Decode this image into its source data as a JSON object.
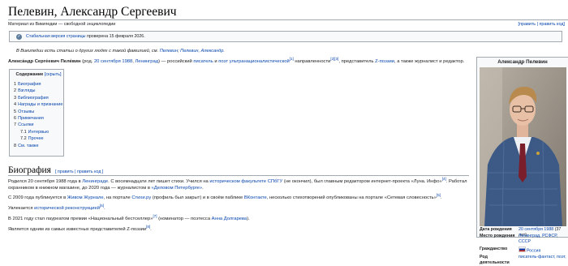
{
  "article": {
    "title": "Пелевин, Александр Сергеевич",
    "tagline": "Материал из Википедии — свободной энциклопедии",
    "edit_link": "[править | править код]"
  },
  "notice": {
    "link": "Стабильная версия страницы",
    "text": " проверена 15 февраля 2026."
  },
  "hatnote": {
    "text": "В Википедии есть статьи о других людях с такой фамилией, см. ",
    "link1": "Пелевин",
    "sep": "; ",
    "link2": "Пелевин, Александр",
    "end": "."
  },
  "lead": {
    "name": "Алекса́ндр Серге́евич Пеле́вин",
    "t1": " (род. ",
    "date": "20 сентября 1988",
    "t2": ", ",
    "place": "Ленинград",
    "t3": ") — российский ",
    "l_writer": "писатель",
    "t4": " и ",
    "l_poet": "поэт ультранационалистической",
    "ref1": "[1]",
    "t5": " направленности",
    "ref2": "[2][3]",
    "t6": ", представитель ",
    "l_z": "Z-поэзии",
    "t7": ", а также журналист и редактор."
  },
  "toc": {
    "title": "Содержание",
    "hide": "[скрыть]",
    "items": [
      {
        "num": "1",
        "label": "Биография"
      },
      {
        "num": "2",
        "label": "Взгляды"
      },
      {
        "num": "3",
        "label": "Библиография"
      },
      {
        "num": "4",
        "label": "Награды и признание"
      },
      {
        "num": "5",
        "label": "Отзывы"
      },
      {
        "num": "6",
        "label": "Примечания"
      },
      {
        "num": "7",
        "label": "Ссылки"
      },
      {
        "num": "7.1",
        "label": "Интервью"
      },
      {
        "num": "7.2",
        "label": "Прочее"
      },
      {
        "num": "8",
        "label": "См. также"
      }
    ]
  },
  "section": {
    "title": "Биография",
    "edit": "[ править | править код ]"
  },
  "bio": {
    "p1a": "Родился 20 сентября 1988 года в ",
    "p1_l1": "Ленинграде",
    "p1b": ". С восемнадцати лет пишет стихи. Учился на ",
    "p1_l2": "историческом факультете СПбГУ",
    "p1c": " (не окончил), был главным редактором интернет-проекта «Луна. Инфо»",
    "p1_ref": "[4]",
    "p1d": ". Работал",
    "p1e": "охранником в книжном магазине, до 2020 года — журналистом в ",
    "p1_l3": "«Деловом Петербурге»",
    "p1f": ".",
    "p2a": "С 2009 года публикуется в ",
    "p2_l1": "Живом Журнале",
    "p2b": ", на портале ",
    "p2_l2": "Стихи.ру",
    "p2c": " (профиль был закрыт) и в своём паблике ",
    "p2_l3": "ВКонтакте",
    "p2d": ", несколько стихотворений опубликованы на портале «Сетевая словесность»",
    "p2_ref": "[5]",
    "p2e": ".",
    "p3a": "Увлекается ",
    "p3_l1": "исторической реконструкцией",
    "p3_ref": "[6]",
    "p3b": ".",
    "p4a": "В 2021 году стал лауреатом премии «Национальный бестселлер»",
    "p4_ref": "[7]",
    "p4b": " (номинатор — поэтесса ",
    "p4_l1": "Анна Долгарева",
    "p4c": ").",
    "p5a": "Является одним из самых известных представителей Z-поэзии",
    "p5_ref": "[8]",
    "p5b": "."
  },
  "infobox": {
    "name": "Александр Пелевин",
    "rows": [
      {
        "key": "Дата рождения",
        "value_link": "20 сентября 1988",
        "value_text": " (37 лет)"
      },
      {
        "key": "Место рождения",
        "value_link": "Ленинград, РСФСР, СССР",
        "value_text": ""
      },
      {
        "key": "Гражданство",
        "value_link": "Россия",
        "value_text": ""
      },
      {
        "key": "Род деятельности",
        "value_link": "писатель-фантаст, поэт,",
        "value_text": ""
      }
    ]
  }
}
